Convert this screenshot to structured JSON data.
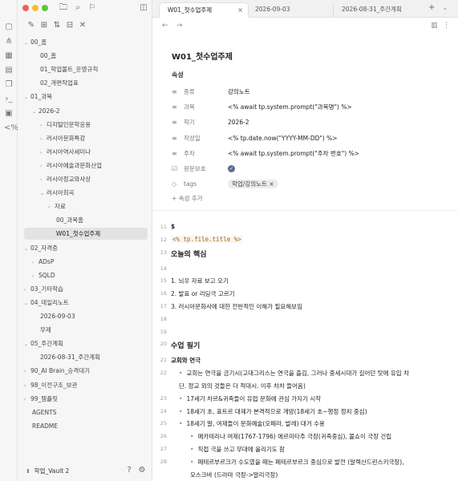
{
  "sidebar": {
    "tree": [
      {
        "label": "00_홈",
        "chev": "⌄"
      },
      {
        "label": "00_홈",
        "chev": ""
      },
      {
        "label": "01_학업볼트_운영규칙",
        "chev": ""
      },
      {
        "label": "02_개편작업표",
        "chev": ""
      },
      {
        "label": "01_과목",
        "chev": "⌄"
      },
      {
        "label": "2026-2",
        "chev": "⌄"
      },
      {
        "label": "디지털인문학응용",
        "chev": "›"
      },
      {
        "label": "러시아문화특강",
        "chev": "›"
      },
      {
        "label": "러시아역사세미나",
        "chev": "›"
      },
      {
        "label": "러시아예술과문화산업",
        "chev": "›"
      },
      {
        "label": "러시아정교와사상",
        "chev": "›"
      },
      {
        "label": "러시아희곡",
        "chev": "⌄"
      },
      {
        "label": "자료",
        "chev": "›"
      },
      {
        "label": "00_과목홈",
        "chev": ""
      },
      {
        "label": "W01_첫수업주제",
        "chev": ""
      },
      {
        "label": "02_자격증",
        "chev": "⌄"
      },
      {
        "label": "ADsP",
        "chev": "›"
      },
      {
        "label": "SQLD",
        "chev": "›"
      },
      {
        "label": "03_기타학습",
        "chev": "›"
      },
      {
        "label": "04_데일리노트",
        "chev": "⌄"
      },
      {
        "label": "2026-09-03",
        "chev": ""
      },
      {
        "label": "무제",
        "chev": ""
      },
      {
        "label": "05_주간계획",
        "chev": "⌄"
      },
      {
        "label": "2026-08-31_주간계획",
        "chev": ""
      },
      {
        "label": "90_AI Brain_승격대기",
        "chev": "›"
      },
      {
        "label": "98_이전구조_보관",
        "chev": "›"
      },
      {
        "label": "99_템플릿",
        "chev": "›"
      },
      {
        "label": "AGENTS",
        "chev": ""
      },
      {
        "label": "README",
        "chev": ""
      }
    ],
    "vault_name": "학업_Vault 2"
  },
  "tabs": [
    {
      "label": "W01_첫수업주제"
    },
    {
      "label": "2026-09-03"
    },
    {
      "label": "2026-08-31_주간계획"
    }
  ],
  "doc": {
    "title": "W01_첫수업주제",
    "props_heading": "속성",
    "props": [
      {
        "icon": "≡",
        "key": "종류",
        "value": "강의노트"
      },
      {
        "icon": "≡",
        "key": "과목",
        "value": "<% await tp.system.prompt(\"과목명\") %>"
      },
      {
        "icon": "≡",
        "key": "학기",
        "value": "2026-2"
      },
      {
        "icon": "≡",
        "key": "작성일",
        "value": "<% tp.date.now(\"YYYY-MM-DD\") %>"
      },
      {
        "icon": "≡",
        "key": "주차",
        "value": "<% await tp.system.prompt(\"주차 번호\") %>"
      },
      {
        "icon": "☑",
        "key": "원문보호",
        "value": ""
      },
      {
        "icon": "◇",
        "key": "tags",
        "value": "학업/강의노트"
      }
    ],
    "add_prop": "속성 추가",
    "lines": [
      {
        "n": "11",
        "text": "$",
        "bold": true
      },
      {
        "n": "12",
        "text": "<% tp.file.title %>",
        "code": true
      },
      {
        "n": "13",
        "text": "오늘의 핵심",
        "bold": true,
        "size": 9
      },
      {
        "n": "14",
        "text": ""
      },
      {
        "n": "15",
        "text": "1.  뇌우 자료 보고 오기"
      },
      {
        "n": "16",
        "text": "2.  발표 or 리딩극 고르기"
      },
      {
        "n": "17",
        "text": "3.  러시아문화사에 대한 전반적인 이해가 필요해보임"
      },
      {
        "n": "18",
        "text": ""
      },
      {
        "n": "19",
        "text": ""
      },
      {
        "n": "20",
        "text": "수업 필기",
        "bold": true,
        "size": 9
      },
      {
        "n": "21",
        "text": "교회와 연극",
        "bold": true
      },
      {
        "n": "22",
        "text": "교회는 연극을 금기시(고대그리스는 연극을 즐김, 그러나 중세시대가 길어던 탓에 유입 차",
        "bullet": 1
      },
      {
        "n": "",
        "text": "단. 정교 외의 것들은 다 적대시. 이후 차차 들어옴)",
        "indent": 1
      },
      {
        "n": "23",
        "text": "17세기 차르&귀족들이 유럽 문화에 관심 가지기 시작",
        "bullet": 1
      },
      {
        "n": "24",
        "text": "18세기 초, 표트르 대제가 본격적으로 개방(18세기 초~행정 정치 중심)",
        "bullet": 1
      },
      {
        "n": "25",
        "text": "18세기 말, 여제들이 문화예술(오페라, 발레) 대거 수용",
        "bullet": 1
      },
      {
        "n": "26",
        "text": "예카테리나 여제(1767-1796) 에르미타주 극장(귀족중심), 볼쇼이 극장 건립",
        "bullet": 2
      },
      {
        "n": "27",
        "text": "직접 극을 쓰고 무대에 올리기도 함",
        "bullet": 2
      },
      {
        "n": "28",
        "text": "페테르부르크가 수도였을 때는 페테르부르크 중심으로 발전  (알렉산드린스키극장),",
        "bullet": 2
      },
      {
        "n": "",
        "text": "모스크바 (드라마 극장->말리극장)",
        "indent": 2
      },
      {
        "n": "29",
        "text": ""
      }
    ]
  }
}
